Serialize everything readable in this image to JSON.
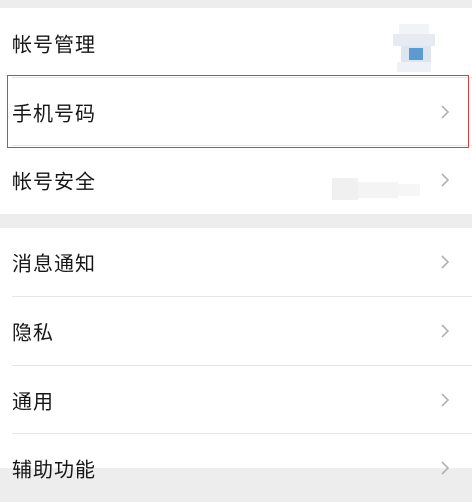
{
  "account_group": {
    "items": [
      {
        "id": "account-management",
        "label": "帐号管理"
      },
      {
        "id": "phone-number",
        "label": "手机号码"
      },
      {
        "id": "account-security",
        "label": "帐号安全"
      }
    ]
  },
  "settings_group": {
    "items": [
      {
        "id": "notifications",
        "label": "消息通知"
      },
      {
        "id": "privacy",
        "label": "隐私"
      },
      {
        "id": "general",
        "label": "通用"
      },
      {
        "id": "accessibility",
        "label": "辅助功能"
      }
    ]
  },
  "icons": {
    "chevron": "chevron-right-icon",
    "avatar": "avatar-blurred"
  },
  "colors": {
    "background": "#ededed",
    "card": "#ffffff",
    "highlight_border": "#e03c3c",
    "chevron": "#b2b2b2",
    "text": "#161616"
  }
}
